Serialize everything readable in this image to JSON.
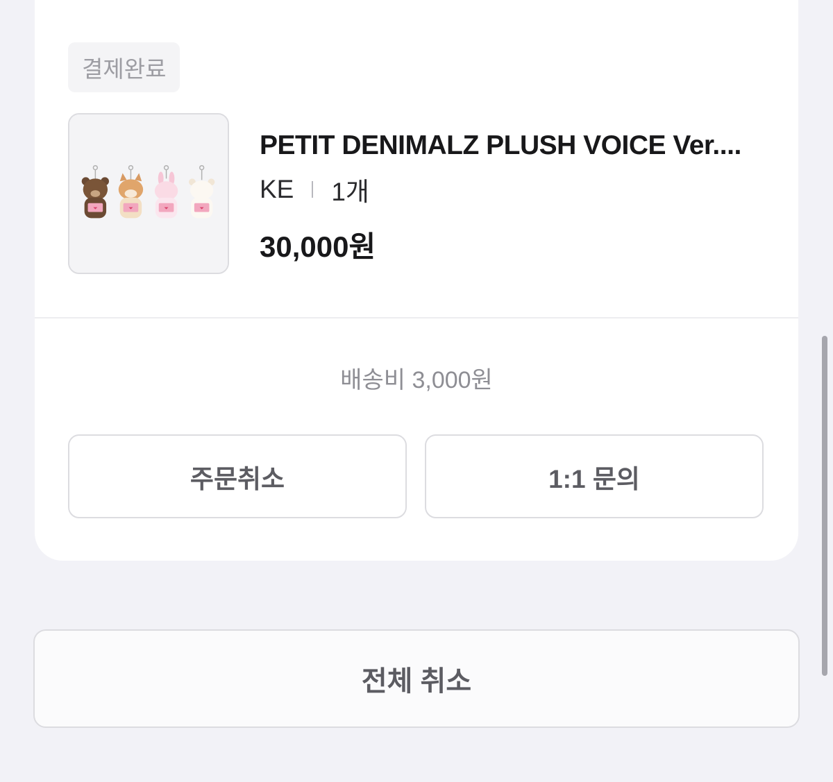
{
  "order": {
    "status_label": "결제완료",
    "product": {
      "title": "PETIT DENIMALZ PLUSH VOICE Ver....",
      "option": "KE",
      "quantity": "1개",
      "price": "30,000원",
      "image_icon": "plush-keyrings-image"
    },
    "shipping_fee": "배송비 3,000원",
    "buttons": {
      "cancel_order": "주문취소",
      "inquiry": "1:1 문의"
    }
  },
  "footer": {
    "cancel_all": "전체 취소"
  },
  "colors": {
    "background": "#f2f2f7",
    "card": "#ffffff",
    "badge_bg": "#f4f4f6",
    "text_primary": "#18181a",
    "text_secondary": "#8e8e94",
    "button_text": "#5c5c62",
    "border": "#dcdce0"
  }
}
